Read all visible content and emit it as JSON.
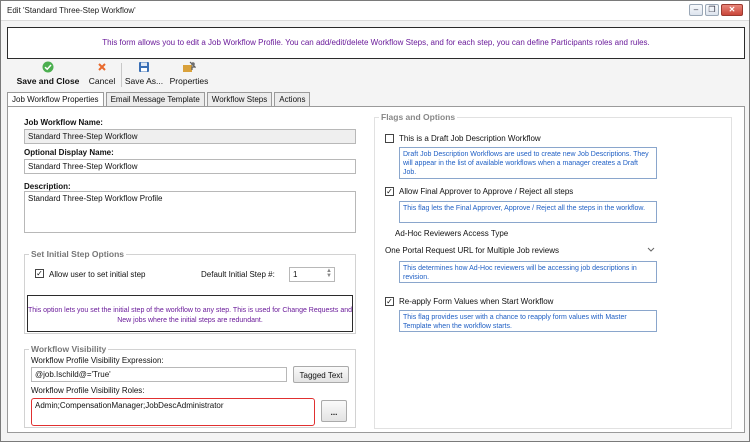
{
  "window": {
    "title": "Edit 'Standard Three-Step Workflow'"
  },
  "banner": "This form allows you to edit a Job Workflow Profile. You can add/edit/delete Workflow Steps, and for each step, you can define Participants roles and rules.",
  "toolbar": {
    "save_close": "Save and Close",
    "cancel": "Cancel",
    "save_as": "Save As...",
    "properties": "Properties"
  },
  "tabs": [
    "Job Workflow Properties",
    "Email Message Template",
    "Workflow Steps",
    "Actions"
  ],
  "left": {
    "name_label": "Job Workflow Name:",
    "name_value": "Standard Three-Step Workflow",
    "display_label": "Optional Display Name:",
    "display_value": "Standard Three-Step Workflow",
    "desc_label": "Description:",
    "desc_value": "Standard Three-Step Workflow Profile",
    "initial": {
      "title": "Set Initial Step Options",
      "allow_label": "Allow user to set initial step",
      "default_label": "Default Initial Step #:",
      "default_value": "1",
      "notice": "This option lets you set the initial step of the workflow to any step.  This is used for Change Requests and New jobs where the initial steps are redundant."
    },
    "visibility": {
      "title": "Workflow Visibility",
      "expr_label": "Workflow Profile Visibility Expression:",
      "expr_value": "@job.Ischild@='True'",
      "tagged_text": "Tagged Text",
      "roles_label": "Workflow Profile Visibility Roles:",
      "roles_value": "Admin;CompensationManager;JobDescAdministrator",
      "ellipsis": "..."
    }
  },
  "right": {
    "title": "Flags and Options",
    "draft_label": "This is a Draft Job Description Workflow",
    "draft_checked": false,
    "draft_hint": "Draft Job Description Workflows are used to create new Job Descriptions. They will appear in the list of available workflows when a manager creates a Draft Job.",
    "final_label": "Allow Final Approver to Approve / Reject all steps",
    "final_checked": true,
    "final_hint": "This flag lets the Final Approver, Approve / Reject all the steps in the workflow.",
    "adhoc_label": "Ad-Hoc Reviewers Access Type",
    "adhoc_value": "One Portal Request URL for Multiple Job reviews",
    "adhoc_hint": "This determines how Ad-Hoc reviewers will be accessing job descriptions in revision.",
    "reapply_label": "Re-apply Form Values when Start Workflow",
    "reapply_checked": true,
    "reapply_hint": "This flag provides user with a chance to reapply form values with Master Template when the workflow starts."
  },
  "colors": {
    "accent_purple": "#6a1b9a",
    "hint_blue": "#1f5fc4",
    "roles_border": "#e03030"
  }
}
